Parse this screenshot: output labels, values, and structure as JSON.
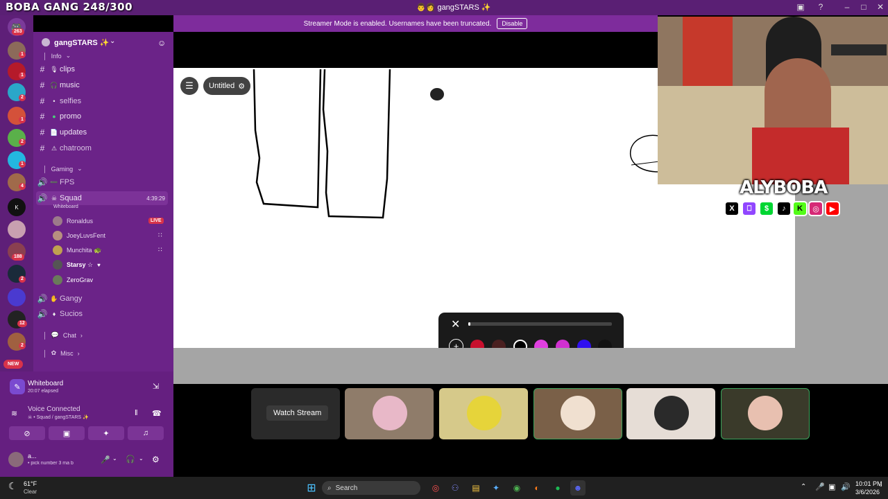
{
  "overlay": {
    "title": "BOBA GANG 248/300",
    "brand": "ALYBOBA"
  },
  "window": {
    "title": "👨‍👩 gangSTARS ✨"
  },
  "banner": {
    "text": "Streamer Mode is enabled. Usernames have been truncated.",
    "button": "Disable"
  },
  "rail": {
    "home_badge": "263",
    "badges": [
      "1",
      "1",
      "2",
      "1",
      "2",
      "1",
      "4",
      "188",
      "2",
      "12",
      "2"
    ],
    "new_label": "NEW"
  },
  "sidebar": {
    "server_name": "gangSTARS ✨",
    "info_category": "Info",
    "channels": [
      {
        "name": "clips",
        "icon": "🎙"
      },
      {
        "name": "music",
        "icon": "🎧"
      },
      {
        "name": "selfies",
        "icon": "•"
      },
      {
        "name": "promo",
        "icon": "●"
      },
      {
        "name": "updates",
        "icon": "📄"
      },
      {
        "name": "chatroom",
        "icon": "⚠"
      }
    ],
    "gaming_category": "Gaming",
    "voice": [
      {
        "name": "FPS",
        "icon": "➖"
      },
      {
        "name": "Squad",
        "time": "4:39:29",
        "activity": "Whiteboard"
      }
    ],
    "users": [
      {
        "name": "Ronaldus",
        "live": "LIVE"
      },
      {
        "name": "JoeyLuvsFent"
      },
      {
        "name": "Munchita 🐢"
      },
      {
        "name": "Starsy ☆"
      },
      {
        "name": "ZeroGrav"
      }
    ],
    "voice2": [
      "Gangy",
      "Sucios"
    ],
    "chat_category": "Chat",
    "misc_category": "Misc"
  },
  "panel": {
    "activity_title": "Whiteboard",
    "activity_elapsed": "20:07 elapsed",
    "voice_status": "Voice Connected",
    "voice_location": "☠ • Squad / gangSTARS ✨",
    "username": "a...",
    "user_status": "• pick number 3 ma b"
  },
  "canvas": {
    "file_name": "Untitled"
  },
  "picker": {
    "colors": [
      "#c8102e",
      "#4a2020",
      "#000000",
      "#e040e0",
      "#d030d0",
      "#3010f0",
      "#111111"
    ]
  },
  "thumbs": {
    "watch_label": "Watch Stream"
  },
  "taskbar": {
    "weather_temp": "61°F",
    "weather_desc": "Clear",
    "search_placeholder": "Search",
    "time": "10:01 PM",
    "date": "3/6/2026"
  }
}
